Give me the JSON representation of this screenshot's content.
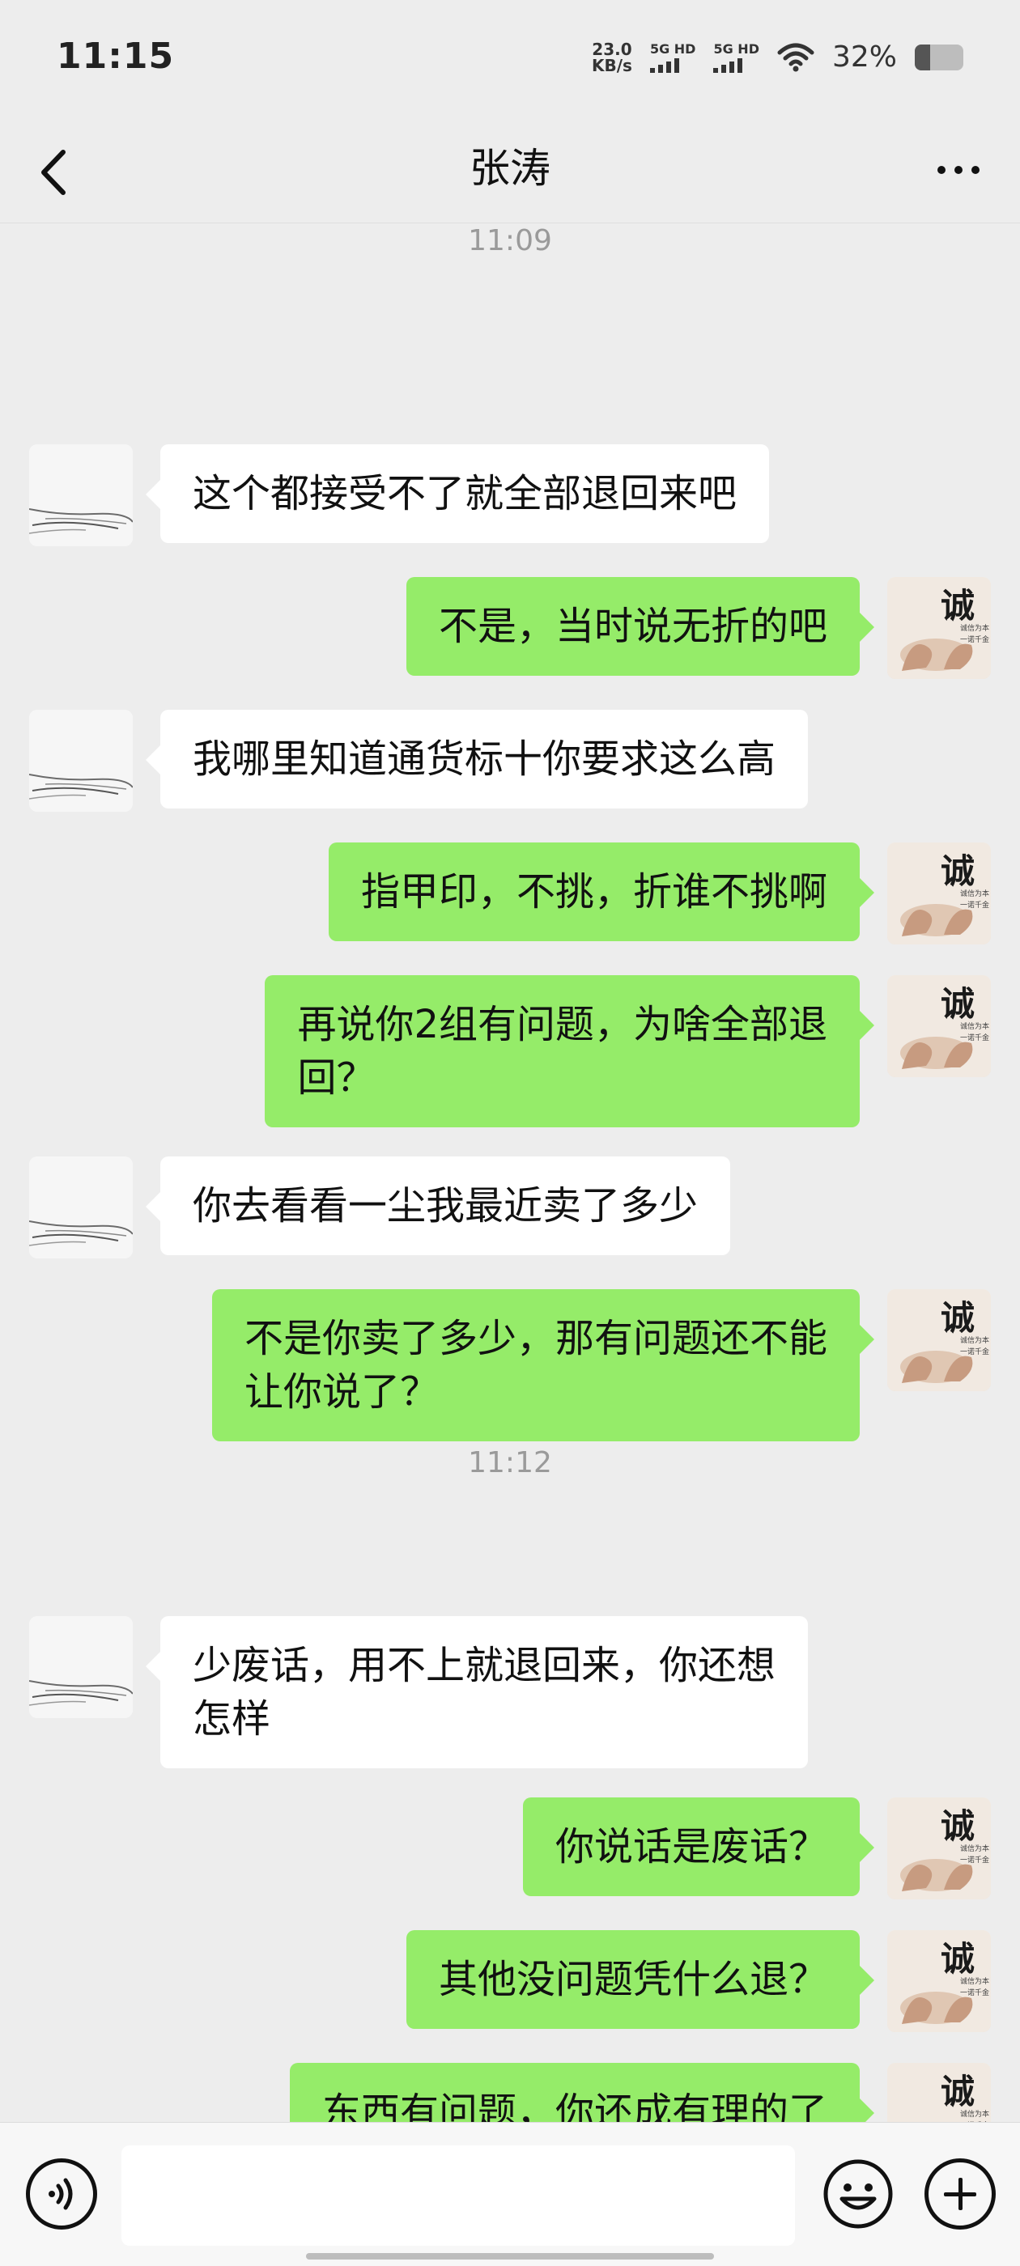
{
  "status_bar": {
    "time": "11:15",
    "net_speed_value": "23.0",
    "net_speed_unit": "KB/s",
    "sim1_label": "5G HD",
    "sim2_label": "5G HD",
    "battery_percent": "32%",
    "battery_level": 0.32
  },
  "header": {
    "title": "张涛",
    "back_icon": "chevron-left-icon",
    "more_icon": "more-horizontal-icon"
  },
  "messages": [
    {
      "type": "message",
      "sender": "self",
      "text": "?",
      "partial": true
    },
    {
      "type": "time",
      "text": "11:09"
    },
    {
      "type": "message",
      "sender": "other",
      "text": "这个都接受不了就全部退回来吧"
    },
    {
      "type": "message",
      "sender": "self",
      "text": "不是，当时说无折的吧"
    },
    {
      "type": "message",
      "sender": "other",
      "text": "我哪里知道通货标十你要求这么高"
    },
    {
      "type": "message",
      "sender": "self",
      "text": "指甲印，不挑，折谁不挑啊"
    },
    {
      "type": "message",
      "sender": "self",
      "text": "再说你2组有问题，为啥全部退\n回？"
    },
    {
      "type": "message",
      "sender": "other",
      "text": "你去看看一尘我最近卖了多少"
    },
    {
      "type": "message",
      "sender": "self",
      "text": "不是你卖了多少，那有问题还不能\n让你说了？"
    },
    {
      "type": "time",
      "text": "11:12"
    },
    {
      "type": "message",
      "sender": "other",
      "text": "少废话，用不上就退回来，你还想\n怎样"
    },
    {
      "type": "message",
      "sender": "self",
      "text": "你说话是废话？"
    },
    {
      "type": "message",
      "sender": "self",
      "text": "其他没问题凭什么退？"
    },
    {
      "type": "message",
      "sender": "self",
      "text": "东西有问题，你还成有理的了",
      "partial": true
    }
  ],
  "avatars": {
    "self_calligraphy": "诚",
    "self_small_text": "诚信为本 一诺千金"
  },
  "input_bar": {
    "voice_icon": "voice-icon",
    "emoji_icon": "emoji-icon",
    "plus_icon": "plus-icon",
    "input_value": ""
  },
  "colors": {
    "background": "#ededed",
    "self_bubble": "#95ec69",
    "other_bubble": "#ffffff",
    "timestamp": "#9a9a9a"
  }
}
